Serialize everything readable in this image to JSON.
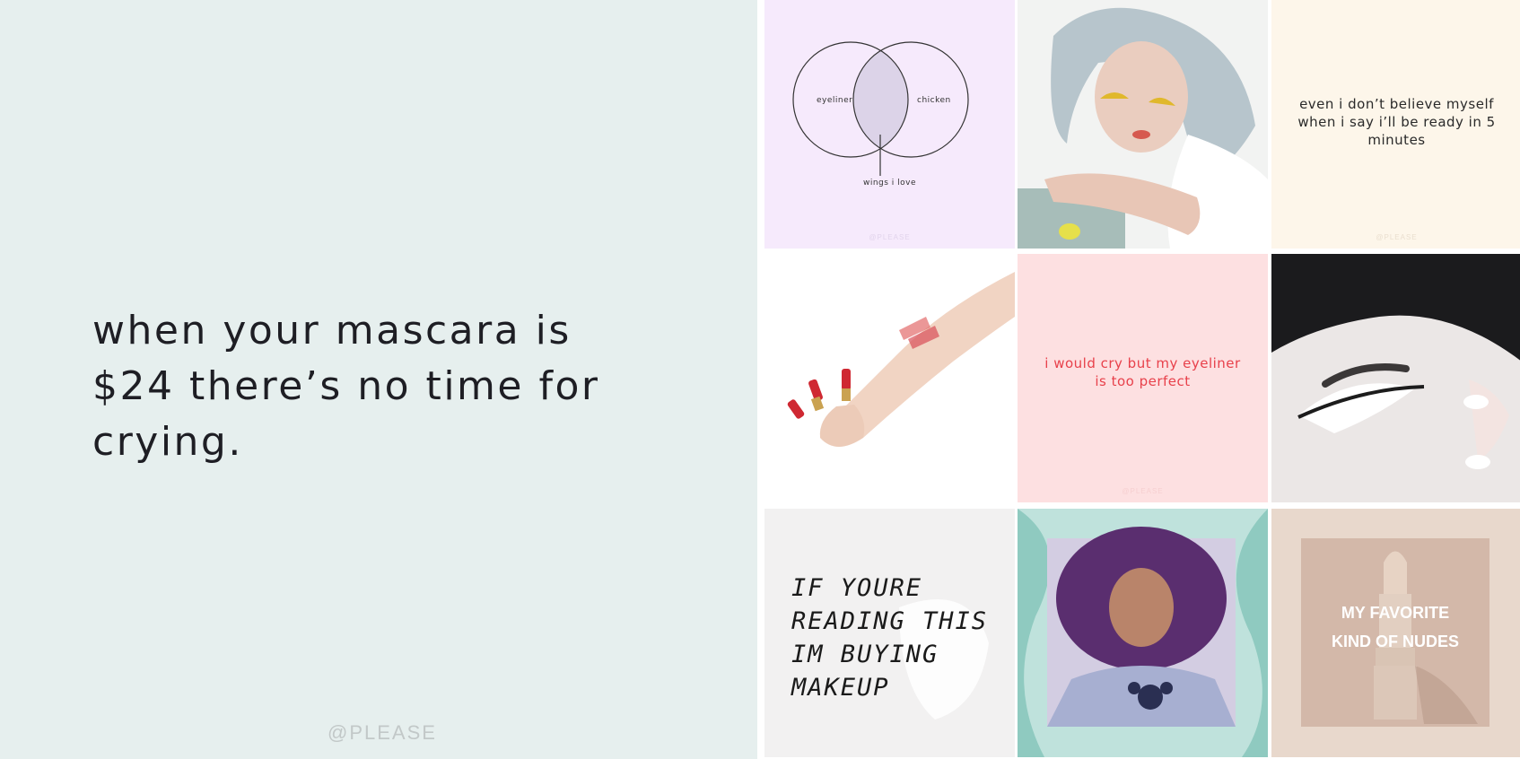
{
  "hero": {
    "quote": "when your mascara is $24 there’s no time for crying.",
    "handle": "@PLEASE"
  },
  "tiles": {
    "venn": {
      "left_label": "eyeliner",
      "right_label": "chicken",
      "bottom_label": "wings i love",
      "handle": "@PLEASE"
    },
    "believe": {
      "quote": "even i don’t believe myself when i say i’ll be ready in 5 minutes",
      "handle": "@PLEASE"
    },
    "cry": {
      "quote": "i would cry but my eyeliner is too perfect",
      "handle": "@PLEASE"
    },
    "drake": {
      "text": "IF YOURE\nREADING THIS\nIM BUYING\nMAKEUP"
    },
    "nudes": {
      "text": "MY FAVORITE\nKIND OF NUDES"
    }
  },
  "colors": {
    "hero_bg": "#e6efee",
    "venn_bg": "#f6eafc",
    "believe_bg": "#fdf6ea",
    "cry_bg": "#fde0e1",
    "cry_text": "#e8414b",
    "nudes_bg": "#e8d8cc",
    "nudes_card": "#d3b8a9"
  },
  "icons": [
    "woman-grey-hair-photo",
    "lipstick-hand-photo",
    "white-liner-eye-photo",
    "curly-hair-photo",
    "lipstick-tube-photo"
  ]
}
